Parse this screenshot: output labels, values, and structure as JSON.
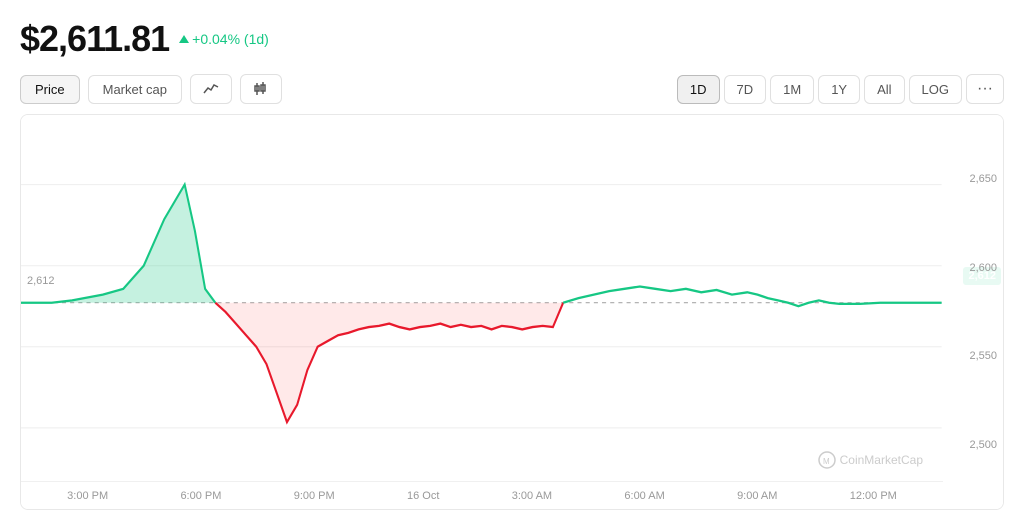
{
  "price": {
    "value": "$2,611.81",
    "change": "+0.04% (1d)"
  },
  "tabs": {
    "price_label": "Price",
    "market_cap_label": "Market cap"
  },
  "time_filters": [
    "1D",
    "7D",
    "1M",
    "1Y",
    "All",
    "LOG"
  ],
  "chart": {
    "current_price": "2,612",
    "open_price": "2,612",
    "y_labels": [
      "2,650",
      "2,600",
      "2,550",
      "2,500"
    ],
    "x_labels": [
      "3:00 PM",
      "6:00 PM",
      "9:00 PM",
      "16 Oct",
      "3:00 AM",
      "6:00 AM",
      "9:00 AM",
      "12:00 PM"
    ],
    "watermark": "CoinMarketCap"
  }
}
